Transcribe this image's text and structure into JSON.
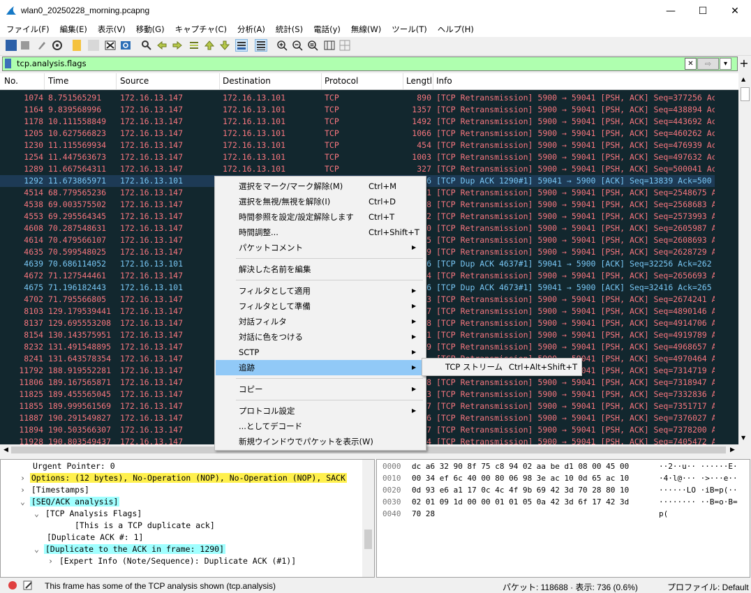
{
  "window": {
    "title": "wlan0_20250228_morning.pcapng",
    "minimize": "—",
    "maximize": "☐",
    "close": "✕"
  },
  "menu": [
    "ファイル(F)",
    "編集(E)",
    "表示(V)",
    "移動(G)",
    "キャプチャ(C)",
    "分析(A)",
    "統計(S)",
    "電話(y)",
    "無線(W)",
    "ツール(T)",
    "ヘルプ(H)"
  ],
  "filter": {
    "value": "tcp.analysis.flags",
    "plus": "+",
    "dropdown": "▾",
    "clear": "✕",
    "apply": "⇨"
  },
  "columns": [
    "No.",
    "Time",
    "Source",
    "Destination",
    "Protocol",
    "Lengtl",
    "Info"
  ],
  "packets": [
    {
      "no": "1074",
      "time": "8.751565291",
      "src": "172.16.13.147",
      "dst": "172.16.13.101",
      "proto": "TCP",
      "len": "890",
      "info": "[TCP Retransmission] 5900 → 59041 [PSH, ACK] Seq=377256 Ac",
      "kind": "retx"
    },
    {
      "no": "1164",
      "time": "9.839568996",
      "src": "172.16.13.147",
      "dst": "172.16.13.101",
      "proto": "TCP",
      "len": "1357",
      "info": "[TCP Retransmission] 5900 → 59041 [PSH, ACK] Seq=438894 Ac",
      "kind": "retx"
    },
    {
      "no": "1178",
      "time": "10.111558849",
      "src": "172.16.13.147",
      "dst": "172.16.13.101",
      "proto": "TCP",
      "len": "1492",
      "info": "[TCP Retransmission] 5900 → 59041 [PSH, ACK] Seq=443692 Ac",
      "kind": "retx"
    },
    {
      "no": "1205",
      "time": "10.627566823",
      "src": "172.16.13.147",
      "dst": "172.16.13.101",
      "proto": "TCP",
      "len": "1066",
      "info": "[TCP Retransmission] 5900 → 59041 [PSH, ACK] Seq=460262 Ac",
      "kind": "retx"
    },
    {
      "no": "1230",
      "time": "11.115569934",
      "src": "172.16.13.147",
      "dst": "172.16.13.101",
      "proto": "TCP",
      "len": "454",
      "info": "[TCP Retransmission] 5900 → 59041 [PSH, ACK] Seq=476939 Ac",
      "kind": "retx"
    },
    {
      "no": "1254",
      "time": "11.447563673",
      "src": "172.16.13.147",
      "dst": "172.16.13.101",
      "proto": "TCP",
      "len": "1003",
      "info": "[TCP Retransmission] 5900 → 59041 [PSH, ACK] Seq=497632 Ac",
      "kind": "retx"
    },
    {
      "no": "1289",
      "time": "11.667564311",
      "src": "172.16.13.147",
      "dst": "172.16.13.101",
      "proto": "TCP",
      "len": "327",
      "info": "[TCP Retransmission] 5900 → 59041 [PSH, ACK] Seq=500041 Ac",
      "kind": "retx"
    },
    {
      "no": "1292",
      "time": "11.673865971",
      "src": "172.16.13.101",
      "dst": "",
      "proto": "",
      "len": "66",
      "info": "[TCP Dup ACK 1290#1] 59041 → 5900 [ACK] Seq=13839 Ack=500",
      "kind": "dup"
    },
    {
      "no": "4514",
      "time": "68.779565236",
      "src": "172.16.13.147",
      "dst": "",
      "proto": "",
      "len": "1",
      "info": "[TCP Retransmission] 5900 → 59041 [PSH, ACK] Seq=2548675 A",
      "kind": "retx"
    },
    {
      "no": "4538",
      "time": "69.003575502",
      "src": "172.16.13.147",
      "dst": "",
      "proto": "",
      "len": "8",
      "info": "[TCP Retransmission] 5900 → 59041 [PSH, ACK] Seq=2568683 A",
      "kind": "retx"
    },
    {
      "no": "4553",
      "time": "69.295564345",
      "src": "172.16.13.147",
      "dst": "",
      "proto": "",
      "len": "2",
      "info": "[TCP Retransmission] 5900 → 59041 [PSH, ACK] Seq=2573993 A",
      "kind": "retx"
    },
    {
      "no": "4608",
      "time": "70.287548631",
      "src": "172.16.13.147",
      "dst": "",
      "proto": "",
      "len": "0",
      "info": "[TCP Retransmission] 5900 → 59041 [PSH, ACK] Seq=2605987 A",
      "kind": "retx"
    },
    {
      "no": "4614",
      "time": "70.479566107",
      "src": "172.16.13.147",
      "dst": "",
      "proto": "",
      "len": "5",
      "info": "[TCP Retransmission] 5900 → 59041 [PSH, ACK] Seq=2608693 A",
      "kind": "retx"
    },
    {
      "no": "4635",
      "time": "70.599548025",
      "src": "172.16.13.147",
      "dst": "",
      "proto": "",
      "len": "9",
      "info": "[TCP Retransmission] 5900 → 59041 [PSH, ACK] Seq=2628729 A",
      "kind": "retx"
    },
    {
      "no": "4639",
      "time": "70.686114052",
      "src": "172.16.13.101",
      "dst": "",
      "proto": "",
      "len": "6",
      "info": "[TCP Dup ACK 4637#1] 59041 → 5900 [ACK] Seq=32256 Ack=262",
      "kind": "dup"
    },
    {
      "no": "4672",
      "time": "71.127544461",
      "src": "172.16.13.147",
      "dst": "",
      "proto": "",
      "len": "4",
      "info": "[TCP Retransmission] 5900 → 59041 [PSH, ACK] Seq=2656693 A",
      "kind": "retx"
    },
    {
      "no": "4675",
      "time": "71.196182443",
      "src": "172.16.13.101",
      "dst": "",
      "proto": "",
      "len": "6",
      "info": "[TCP Dup ACK 4673#1] 59041 → 5900 [ACK] Seq=32416 Ack=265",
      "kind": "dup"
    },
    {
      "no": "4702",
      "time": "71.795566805",
      "src": "172.16.13.147",
      "dst": "",
      "proto": "",
      "len": "3",
      "info": "[TCP Retransmission] 5900 → 59041 [PSH, ACK] Seq=2674241 A",
      "kind": "retx"
    },
    {
      "no": "8103",
      "time": "129.179539441",
      "src": "172.16.13.147",
      "dst": "",
      "proto": "",
      "len": "7",
      "info": "[TCP Retransmission] 5900 → 59041 [PSH, ACK] Seq=4890146 A",
      "kind": "retx"
    },
    {
      "no": "8137",
      "time": "129.695553208",
      "src": "172.16.13.147",
      "dst": "",
      "proto": "",
      "len": "8",
      "info": "[TCP Retransmission] 5900 → 59041 [PSH, ACK] Seq=4914706 A",
      "kind": "retx"
    },
    {
      "no": "8154",
      "time": "130.143575951",
      "src": "172.16.13.147",
      "dst": "",
      "proto": "",
      "len": "1",
      "info": "[TCP Retransmission] 5900 → 59041 [PSH, ACK] Seq=4919789 A",
      "kind": "retx"
    },
    {
      "no": "8232",
      "time": "131.491548895",
      "src": "172.16.13.147",
      "dst": "",
      "proto": "",
      "len": "9",
      "info": "[TCP Retransmission] 5900 → 59041 [PSH, ACK] Seq=4968657 A",
      "kind": "retx"
    },
    {
      "no": "8241",
      "time": "131.643578354",
      "src": "172.16.13.147",
      "dst": "",
      "proto": "",
      "len": "",
      "info": "[TCP Retransmission] 5900 → 59041 [PSH, ACK] Seq=4970464 A",
      "kind": "retx"
    },
    {
      "no": "11792",
      "time": "188.919552281",
      "src": "172.16.13.147",
      "dst": "",
      "proto": "",
      "len": "8",
      "info": "[TCP Retransmission] 5900 → 59041 [PSH, ACK] Seq=7314719 A",
      "kind": "retx"
    },
    {
      "no": "11806",
      "time": "189.167565871",
      "src": "172.16.13.147",
      "dst": "",
      "proto": "",
      "len": "8",
      "info": "[TCP Retransmission] 5900 → 59041 [PSH, ACK] Seq=7318947 A",
      "kind": "retx"
    },
    {
      "no": "11825",
      "time": "189.455565045",
      "src": "172.16.13.147",
      "dst": "",
      "proto": "",
      "len": "3",
      "info": "[TCP Retransmission] 5900 → 59041 [PSH, ACK] Seq=7332836 A",
      "kind": "retx"
    },
    {
      "no": "11855",
      "time": "189.999561569",
      "src": "172.16.13.147",
      "dst": "",
      "proto": "",
      "len": "7",
      "info": "[TCP Retransmission] 5900 → 59041 [PSH, ACK] Seq=7351717 A",
      "kind": "retx"
    },
    {
      "no": "11887",
      "time": "190.291549827",
      "src": "172.16.13.147",
      "dst": "",
      "proto": "",
      "len": "6",
      "info": "[TCP Retransmission] 5900 → 59041 [PSH, ACK] Seq=7376027 A",
      "kind": "retx"
    },
    {
      "no": "11894",
      "time": "190.503566307",
      "src": "172.16.13.147",
      "dst": "",
      "proto": "",
      "len": "7",
      "info": "[TCP Retransmission] 5900 → 59041 [PSH, ACK] Seq=7378200 A",
      "kind": "retx"
    },
    {
      "no": "11928",
      "time": "190.803549437",
      "src": "172.16.13.147",
      "dst": "",
      "proto": "",
      "len": "4",
      "info": "[TCP Retransmission] 5900 → 59041 [PSH, ACK] Seq=7405472 A",
      "kind": "retx"
    }
  ],
  "details": [
    {
      "indent": 0,
      "arrow": "",
      "text": "Urgent Pointer: 0",
      "hl": ""
    },
    {
      "indent": 0,
      "arrow": ">",
      "text": "Options: (12 bytes), No-Operation (NOP), No-Operation (NOP), SACK",
      "hl": "#fff04d"
    },
    {
      "indent": 0,
      "arrow": ">",
      "text": "[Timestamps]",
      "hl": ""
    },
    {
      "indent": 0,
      "arrow": "v",
      "text": "[SEQ/ACK analysis]",
      "hl": "#a0ffff"
    },
    {
      "indent": 1,
      "arrow": "v",
      "text": "[TCP Analysis Flags]",
      "hl": ""
    },
    {
      "indent": 3,
      "arrow": "",
      "text": "[This is a TCP duplicate ack]",
      "hl": ""
    },
    {
      "indent": 1,
      "arrow": "",
      "text": "[Duplicate ACK #: 1]",
      "hl": ""
    },
    {
      "indent": 1,
      "arrow": "v",
      "text": "[Duplicate to the ACK in frame: 1290]",
      "hl": "#a0ffff"
    },
    {
      "indent": 2,
      "arrow": ">",
      "text": "[Expert Info (Note/Sequence): Duplicate ACK (#1)]",
      "hl": ""
    }
  ],
  "hexdump": [
    {
      "offset": "0000",
      "hex": "dc a6 32 90 8f 75 c8 94  02 aa be d1 08 00 45 00",
      "ascii": "··2··u·· ······E·"
    },
    {
      "offset": "0010",
      "hex": "00 34 ef 6c 40 00 80 06  98 3e ac 10 0d 65 ac 10",
      "ascii": "·4·l@··· ·>···e··"
    },
    {
      "offset": "0020",
      "hex": "0d 93 e6 a1 17 0c 4c 4f  9b 69 42 3d 70 28 80 10",
      "ascii": "······LO ·iB=p(··"
    },
    {
      "offset": "0030",
      "hex": "02 01 09 1d 00 00 01 01  05 0a 42 3d 6f 17 42 3d",
      "ascii": "········ ··B=o·B="
    },
    {
      "offset": "0040",
      "hex": "70 28",
      "ascii": "p("
    }
  ],
  "status": {
    "message": "This frame has some of the TCP analysis shown (tcp.analysis)",
    "packets": "パケット: 118688 · 表示: 736 (0.6%)",
    "profile": "プロファイル: Default"
  },
  "context_menu": [
    {
      "label": "選択をマーク/マーク解除(M)",
      "shortcut": "Ctrl+M",
      "arrow": false
    },
    {
      "label": "選択を無視/無視を解除(I)",
      "shortcut": "Ctrl+D",
      "arrow": false
    },
    {
      "label": "時間参照を設定/設定解除します",
      "shortcut": "Ctrl+T",
      "arrow": false
    },
    {
      "label": "時間調整...",
      "shortcut": "Ctrl+Shift+T",
      "arrow": false
    },
    {
      "label": "パケットコメント",
      "shortcut": "",
      "arrow": true
    },
    {
      "sep": true
    },
    {
      "label": "解決した名前を編集",
      "shortcut": "",
      "arrow": false
    },
    {
      "sep": true
    },
    {
      "label": "フィルタとして適用",
      "shortcut": "",
      "arrow": true
    },
    {
      "label": "フィルタとして準備",
      "shortcut": "",
      "arrow": true
    },
    {
      "label": "対話フィルタ",
      "shortcut": "",
      "arrow": true
    },
    {
      "label": "対話に色をつける",
      "shortcut": "",
      "arrow": true
    },
    {
      "label": "SCTP",
      "shortcut": "",
      "arrow": true
    },
    {
      "label": "追跡",
      "shortcut": "",
      "arrow": true,
      "hot": true
    },
    {
      "sep": true
    },
    {
      "label": "コピー",
      "shortcut": "",
      "arrow": true
    },
    {
      "sep": true
    },
    {
      "label": "プロトコル設定",
      "shortcut": "",
      "arrow": true
    },
    {
      "label": "...としてデコード",
      "shortcut": "",
      "arrow": false
    },
    {
      "label": "新規ウインドウでパケットを表示(W)",
      "shortcut": "",
      "arrow": false
    }
  ],
  "submenu": {
    "label": "TCP ストリーム",
    "shortcut": "Ctrl+Alt+Shift+T"
  },
  "colors": {
    "retransmission_fg": "#f7767e",
    "dup_ack_fg": "#79c7f5",
    "list_bg": "#12272e",
    "filter_ok_bg": "#afffaf",
    "menu_hot": "#91c9f7"
  }
}
